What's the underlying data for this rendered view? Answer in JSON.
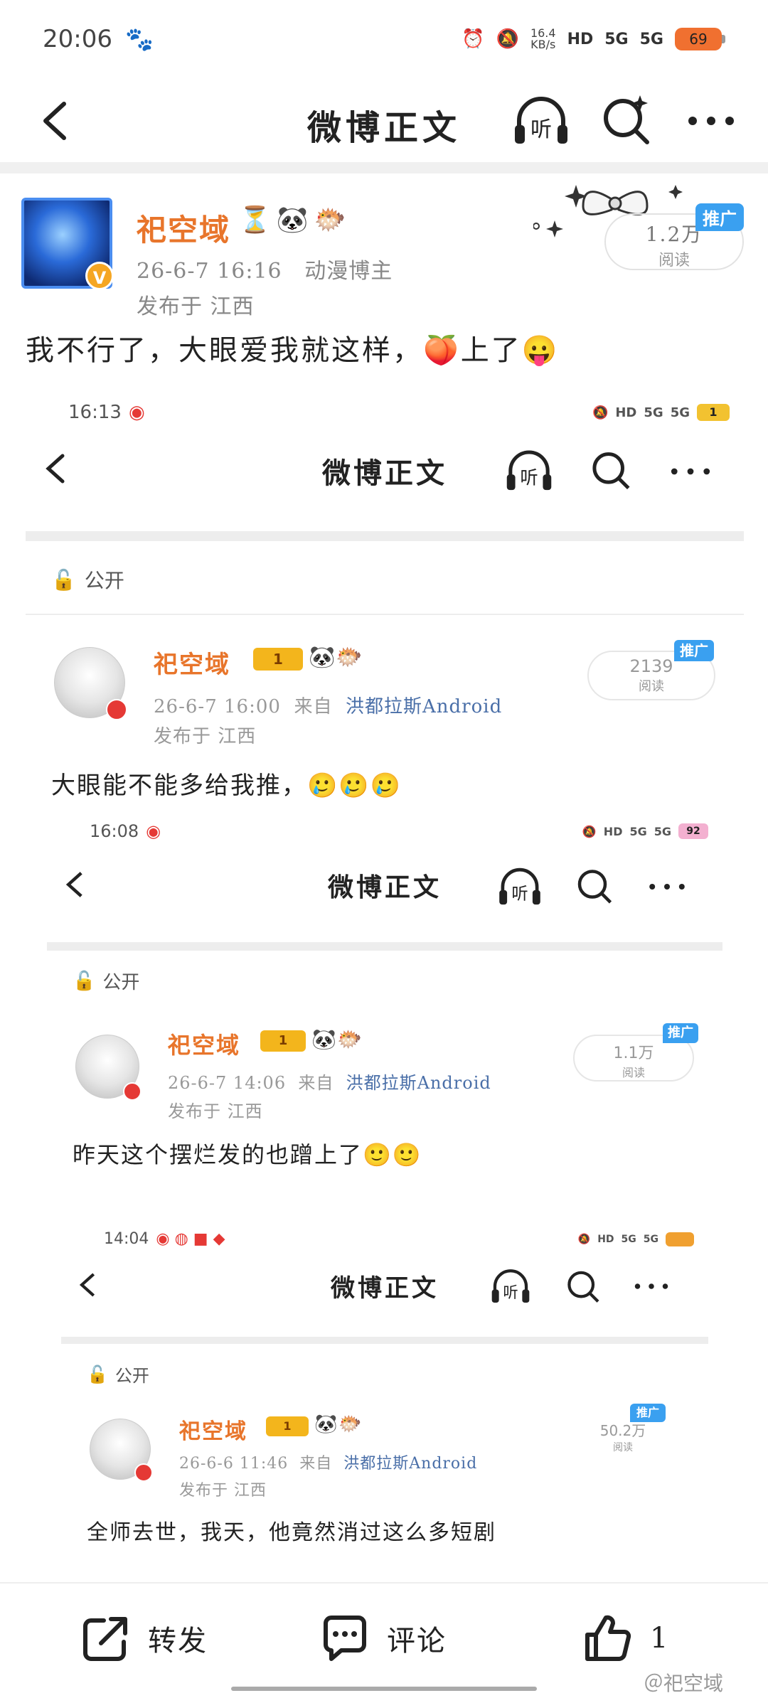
{
  "status_bar": {
    "time": "20:06",
    "net_speed_top": "16.4",
    "net_speed_bottom": "KB/s",
    "hd_label": "HD",
    "signal1": "5G",
    "signal2": "5G",
    "battery": "69"
  },
  "nav": {
    "title": "微博正文",
    "listen_label": "听"
  },
  "post": {
    "author": "祀空域",
    "badges": [
      "⏳",
      "🐼",
      "🐡"
    ],
    "time": "26-6-7 16:16",
    "role": "动漫博主",
    "location": "发布于 江西",
    "reads_count": "1.2万",
    "reads_label": "阅读",
    "promo": "推广",
    "text": "我不行了，大眼爱我就这样，🍑上了😛"
  },
  "embedded": {
    "levels": [
      {
        "status_time": "16:13",
        "battery": "1",
        "nav_title": "微博正文",
        "listen_label": "听",
        "lock_label": "公开",
        "author": "祀空域",
        "crown_num": "1",
        "time": "26-6-7 16:00",
        "from": "来自",
        "source": "洪都拉斯Android",
        "location": "发布于 江西",
        "reads_count": "2139",
        "reads_label": "阅读",
        "promo": "推广",
        "text": "大眼能不能多给我推，🥲🥲🥲"
      },
      {
        "status_time": "16:08",
        "battery": "92",
        "nav_title": "微博正文",
        "listen_label": "听",
        "lock_label": "公开",
        "author": "祀空域",
        "crown_num": "1",
        "time": "26-6-7 14:06",
        "from": "来自",
        "source": "洪都拉斯Android",
        "location": "发布于 江西",
        "reads_count": "1.1万",
        "reads_label": "阅读",
        "promo": "推广",
        "text": "昨天这个摆烂发的也蹭上了🙂🙂"
      },
      {
        "status_time": "14:04",
        "battery": "",
        "nav_title": "微博正文",
        "listen_label": "听",
        "lock_label": "公开",
        "author": "祀空域",
        "crown_num": "1",
        "time": "26-6-6 11:46",
        "from": "来自",
        "source": "洪都拉斯Android",
        "location": "发布于 江西",
        "reads_count": "50.2万",
        "reads_label": "阅读",
        "promo": "推广",
        "text": "全师去世，我天，他竟然消过这么多短剧"
      }
    ]
  },
  "bottom_bar": {
    "repost": "转发",
    "comment": "评论",
    "like_count": "1"
  },
  "watermark": "＠祀空域",
  "colors": {
    "author": "#e8752b",
    "promo": "#3aa0f0",
    "battery": "#f07030"
  }
}
